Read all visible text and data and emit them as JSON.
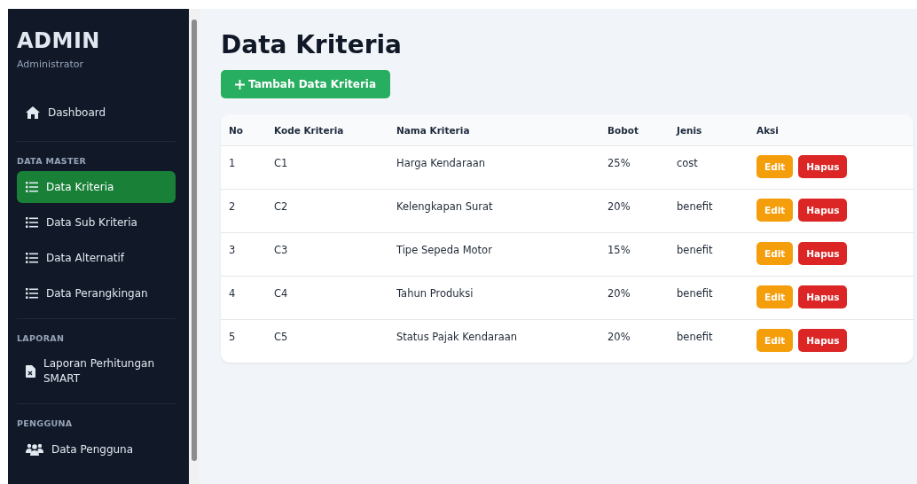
{
  "sidebar": {
    "title": "ADMIN",
    "subtitle": "Administrator",
    "sections": [
      {
        "items": [
          {
            "label": "Dashboard",
            "kind": "home",
            "selected": false
          }
        ]
      },
      {
        "heading": "DATA MASTER",
        "items": [
          {
            "label": "Data Kriteria",
            "kind": "list",
            "selected": true
          },
          {
            "label": "Data Sub Kriteria",
            "kind": "list",
            "selected": false
          },
          {
            "label": "Data Alternatif",
            "kind": "list",
            "selected": false
          },
          {
            "label": "Data Perangkingan",
            "kind": "list",
            "selected": false
          }
        ]
      },
      {
        "heading": "LAPORAN",
        "items": [
          {
            "label": "Laporan Perhitungan SMART",
            "kind": "report",
            "selected": false
          }
        ]
      },
      {
        "heading": "PENGGUNA",
        "items": [
          {
            "label": "Data Pengguna",
            "kind": "users",
            "selected": false
          }
        ]
      }
    ]
  },
  "page": {
    "title": "Data Kriteria",
    "add_button": "Tambah Data Kriteria"
  },
  "table": {
    "columns": [
      "No",
      "Kode Kriteria",
      "Nama Kriteria",
      "Bobot",
      "Jenis",
      "Aksi"
    ],
    "rows": [
      {
        "cells": [
          "1",
          "C1",
          "Harga Kendaraan",
          "25%",
          "cost"
        ],
        "actions": [
          {
            "label": "Edit",
            "kind": "edit"
          },
          {
            "label": "Hapus",
            "kind": "delete"
          }
        ]
      },
      {
        "cells": [
          "2",
          "C2",
          "Kelengkapan Surat",
          "20%",
          "benefit"
        ],
        "actions": [
          {
            "label": "Edit",
            "kind": "edit"
          },
          {
            "label": "Hapus",
            "kind": "delete"
          }
        ]
      },
      {
        "cells": [
          "3",
          "C3",
          "Tipe Sepeda Motor",
          "15%",
          "benefit"
        ],
        "actions": [
          {
            "label": "Edit",
            "kind": "edit"
          },
          {
            "label": "Hapus",
            "kind": "delete"
          }
        ]
      },
      {
        "cells": [
          "4",
          "C4",
          "Tahun Produksi",
          "20%",
          "benefit"
        ],
        "actions": [
          {
            "label": "Edit",
            "kind": "edit"
          },
          {
            "label": "Hapus",
            "kind": "delete"
          }
        ]
      },
      {
        "cells": [
          "5",
          "C5",
          "Status Pajak Kendaraan",
          "20%",
          "benefit"
        ],
        "actions": [
          {
            "label": "Edit",
            "kind": "edit"
          },
          {
            "label": "Hapus",
            "kind": "delete"
          }
        ]
      }
    ]
  }
}
